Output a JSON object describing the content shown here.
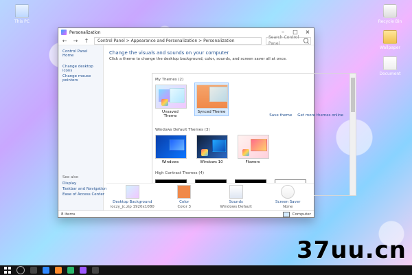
{
  "desktop": {
    "icons": [
      {
        "label": "This PC"
      },
      {
        "label": "Recycle Bin"
      },
      {
        "label": "Wallpaper"
      },
      {
        "label": "Document"
      }
    ]
  },
  "window": {
    "title": "Personalization",
    "breadcrumb": "Control Panel  >  Appearance and Personalization  >  Personalization",
    "search_placeholder": "Search Control Panel",
    "left_nav": {
      "home": "Control Panel Home",
      "links": [
        "Change desktop icons",
        "Change mouse pointers"
      ],
      "see_also_header": "See also",
      "see_also": [
        "Display",
        "Taskbar and Navigation",
        "Ease of Access Center"
      ]
    },
    "main": {
      "heading": "Change the visuals and sounds on your computer",
      "description": "Click a theme to change the desktop background, color, sounds, and screen saver all at once.",
      "my_themes_title": "My Themes (2)",
      "my_themes": [
        {
          "name": "Unsaved Theme"
        },
        {
          "name": "Synced Theme"
        }
      ],
      "right_links": [
        "Save theme",
        "Get more themes online"
      ],
      "default_title": "Windows Default Themes (3)",
      "default_themes": [
        {
          "name": "Windows"
        },
        {
          "name": "Windows 10"
        },
        {
          "name": "Flowers"
        }
      ],
      "hc_title": "High Contrast Themes (4)"
    },
    "bottom_items": [
      {
        "label": "Desktop Background",
        "sub": "ioczy_jc.zip 1920x1080"
      },
      {
        "label": "Color",
        "sub": "Color 3"
      },
      {
        "label": "Sounds",
        "sub": "Windows Default"
      },
      {
        "label": "Screen Saver",
        "sub": "None"
      }
    ],
    "status": {
      "left": "8 items",
      "right": "Computer"
    }
  },
  "watermark": "37uu.cn"
}
